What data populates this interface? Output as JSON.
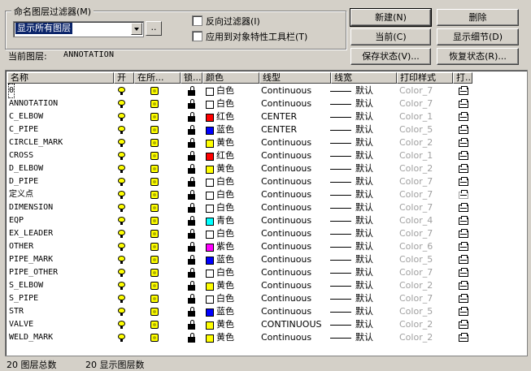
{
  "filter": {
    "group_title": "命名图层过滤器(M)",
    "selected": "显示所有图层",
    "more_button": "..",
    "invert_label": "反向过滤器(I)",
    "apply_toolbar_label": "应用到对象特性工具栏(T)"
  },
  "buttons": {
    "new": "新建(N)",
    "delete": "删除",
    "current": "当前(C)",
    "show_details": "显示细节(D)",
    "save_state": "保存状态(V)...",
    "restore_state": "恢复状态(R)..."
  },
  "current_layer": {
    "label": "当前图层:",
    "value": "ANNOTATION"
  },
  "table": {
    "headers": [
      "名称",
      "开",
      "在所...",
      "锁...",
      "颜色",
      "线型",
      "线宽",
      "打印样式",
      "打..."
    ],
    "rows": [
      {
        "name": "0",
        "color_name": "白色",
        "color_hex": "#ffffff",
        "linetype": "Continuous",
        "lineweight": "默认",
        "plot_style": "Color_7",
        "plot_gray": false
      },
      {
        "name": "ANNOTATION",
        "color_name": "白色",
        "color_hex": "#ffffff",
        "linetype": "Continuous",
        "lineweight": "默认",
        "plot_style": "Color_7",
        "plot_gray": false
      },
      {
        "name": "C_ELBOW",
        "color_name": "红色",
        "color_hex": "#ff0000",
        "linetype": "CENTER",
        "lineweight": "默认",
        "plot_style": "Color_1",
        "plot_gray": false
      },
      {
        "name": "C_PIPE",
        "color_name": "蓝色",
        "color_hex": "#0000ff",
        "linetype": "CENTER",
        "lineweight": "默认",
        "plot_style": "Color_5",
        "plot_gray": false
      },
      {
        "name": "CIRCLE_MARK",
        "color_name": "黄色",
        "color_hex": "#ffff00",
        "linetype": "Continuous",
        "lineweight": "默认",
        "plot_style": "Color_2",
        "plot_gray": false
      },
      {
        "name": "CROSS",
        "color_name": "红色",
        "color_hex": "#ff0000",
        "linetype": "Continuous",
        "lineweight": "默认",
        "plot_style": "Color_1",
        "plot_gray": false
      },
      {
        "name": "D_ELBOW",
        "color_name": "黄色",
        "color_hex": "#ffff00",
        "linetype": "Continuous",
        "lineweight": "默认",
        "plot_style": "Color_2",
        "plot_gray": false
      },
      {
        "name": "D_PIPE",
        "color_name": "白色",
        "color_hex": "#ffffff",
        "linetype": "Continuous",
        "lineweight": "默认",
        "plot_style": "Color_7",
        "plot_gray": false
      },
      {
        "name": "定义点",
        "color_name": "白色",
        "color_hex": "#ffffff",
        "linetype": "Continuous",
        "lineweight": "默认",
        "plot_style": "Color_7",
        "plot_gray": true
      },
      {
        "name": "DIMENSION",
        "color_name": "白色",
        "color_hex": "#ffffff",
        "linetype": "Continuous",
        "lineweight": "默认",
        "plot_style": "Color_7",
        "plot_gray": false
      },
      {
        "name": "EQP",
        "color_name": "青色",
        "color_hex": "#00ffff",
        "linetype": "Continuous",
        "lineweight": "默认",
        "plot_style": "Color_4",
        "plot_gray": false
      },
      {
        "name": "EX_LEADER",
        "color_name": "白色",
        "color_hex": "#ffffff",
        "linetype": "Continuous",
        "lineweight": "默认",
        "plot_style": "Color_7",
        "plot_gray": false
      },
      {
        "name": "OTHER",
        "color_name": "紫色",
        "color_hex": "#ff00ff",
        "linetype": "Continuous",
        "lineweight": "默认",
        "plot_style": "Color_6",
        "plot_gray": false
      },
      {
        "name": "PIPE_MARK",
        "color_name": "蓝色",
        "color_hex": "#0000ff",
        "linetype": "Continuous",
        "lineweight": "默认",
        "plot_style": "Color_5",
        "plot_gray": false
      },
      {
        "name": "PIPE_OTHER",
        "color_name": "白色",
        "color_hex": "#ffffff",
        "linetype": "Continuous",
        "lineweight": "默认",
        "plot_style": "Color_7",
        "plot_gray": false
      },
      {
        "name": "S_ELBOW",
        "color_name": "黄色",
        "color_hex": "#ffff00",
        "linetype": "Continuous",
        "lineweight": "默认",
        "plot_style": "Color_2",
        "plot_gray": false
      },
      {
        "name": "S_PIPE",
        "color_name": "白色",
        "color_hex": "#ffffff",
        "linetype": "Continuous",
        "lineweight": "默认",
        "plot_style": "Color_7",
        "plot_gray": false
      },
      {
        "name": "STR",
        "color_name": "蓝色",
        "color_hex": "#0000ff",
        "linetype": "Continuous",
        "lineweight": "默认",
        "plot_style": "Color_5",
        "plot_gray": false
      },
      {
        "name": "VALVE",
        "color_name": "黄色",
        "color_hex": "#ffff00",
        "linetype": "CONTINUOUS",
        "lineweight": "默认",
        "plot_style": "Color_2",
        "plot_gray": false
      },
      {
        "name": "WELD_MARK",
        "color_name": "黄色",
        "color_hex": "#ffff00",
        "linetype": "Continuous",
        "lineweight": "默认",
        "plot_style": "Color_2",
        "plot_gray": false
      }
    ]
  },
  "status": {
    "total": "20 图层总数",
    "shown": "20 显示图层数"
  },
  "icons": {
    "on": "lightbulb-icon",
    "freeze": "sun-icon",
    "lock": "unlocked-padlock-icon",
    "plot": "printer-icon"
  }
}
